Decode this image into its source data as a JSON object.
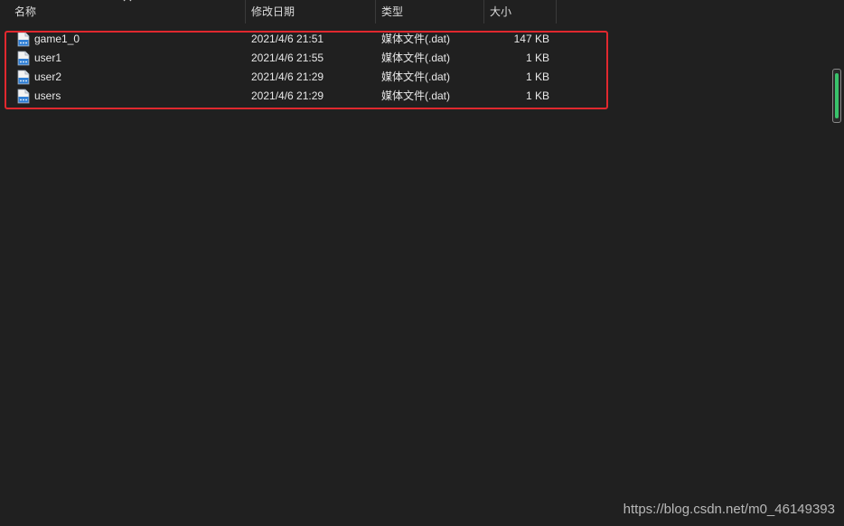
{
  "columns": {
    "name": "名称",
    "modified": "修改日期",
    "type": "类型",
    "size": "大小"
  },
  "files": [
    {
      "name": "game1_0",
      "modified": "2021/4/6 21:51",
      "type": "媒体文件(.dat)",
      "size": "147 KB"
    },
    {
      "name": "user1",
      "modified": "2021/4/6 21:55",
      "type": "媒体文件(.dat)",
      "size": "1 KB"
    },
    {
      "name": "user2",
      "modified": "2021/4/6 21:29",
      "type": "媒体文件(.dat)",
      "size": "1 KB"
    },
    {
      "name": "users",
      "modified": "2021/4/6 21:29",
      "type": "媒体文件(.dat)",
      "size": "1 KB"
    }
  ],
  "icons": {
    "file": "dat-file-icon",
    "sort": "sort-up-icon"
  },
  "colors": {
    "background": "#202020",
    "highlight": "#e0282e",
    "scroll_thumb": "#39c26b",
    "file_icon": "#2f7fd6"
  },
  "watermark": "https://blog.csdn.net/m0_46149393"
}
